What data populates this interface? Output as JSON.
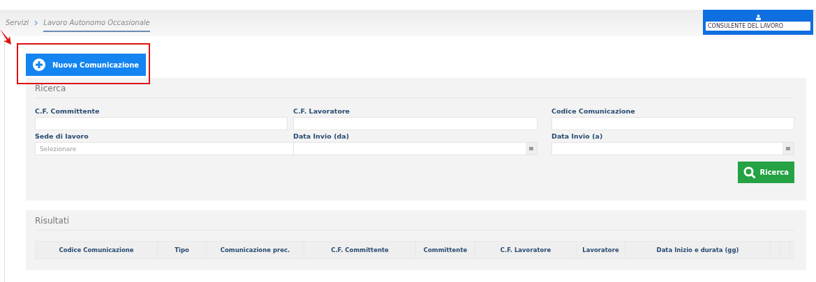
{
  "breadcrumb": [
    {
      "label": "Servizi",
      "selected": false
    },
    {
      "label": "Lavoro Autonomo Occasionale",
      "selected": true
    }
  ],
  "user_panel": {
    "role": "CONSULENTE DEL LAVORO"
  },
  "new_button": {
    "label": "Nuova Comunicazione"
  },
  "search": {
    "title": "Ricerca",
    "fields": [
      {
        "label": "C.F. Committente",
        "kind": "text"
      },
      {
        "label": "C.F. Lavoratore",
        "kind": "text"
      },
      {
        "label": "Codice Comunicazione",
        "kind": "text"
      },
      {
        "label": "Sede di lavoro",
        "kind": "select",
        "placeholder": "Selezionare"
      },
      {
        "label": "Data Invio (da)",
        "kind": "date"
      },
      {
        "label": "Data Invio (a)",
        "kind": "date"
      }
    ],
    "button": "Ricerca"
  },
  "results": {
    "title": "Risultati",
    "columns": [
      "Codice Comunicazione",
      "Tipo",
      "Comunicazione prec.",
      "C.F. Committente",
      "Committente",
      "C.F. Lavoratore",
      "Lavoratore",
      "Data Inizio e durata (gg)"
    ]
  }
}
